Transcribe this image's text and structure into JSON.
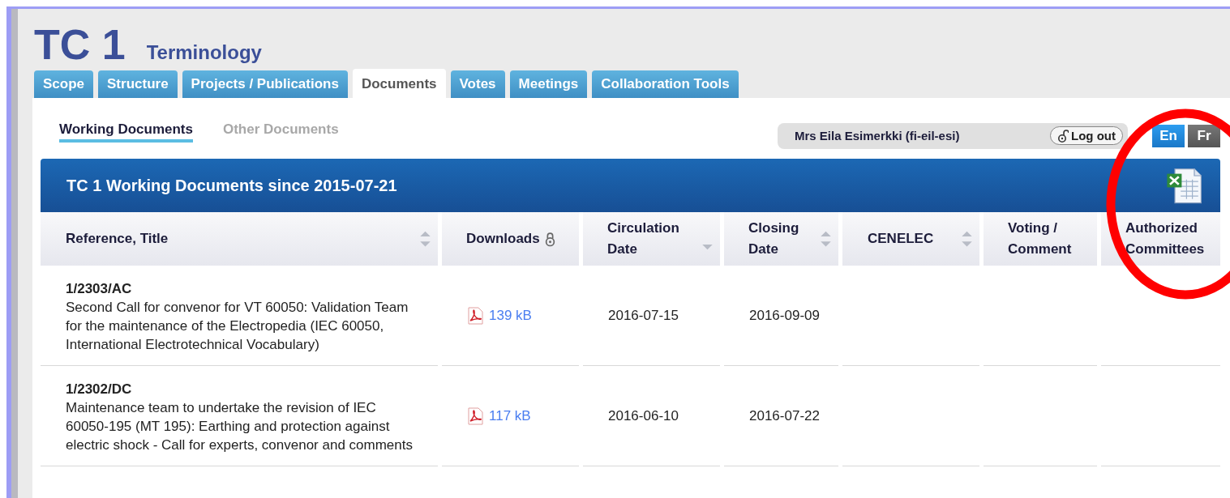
{
  "header": {
    "code": "TC 1",
    "name": "Terminology"
  },
  "tabs": [
    {
      "label": "Scope",
      "selected": false
    },
    {
      "label": "Structure",
      "selected": false
    },
    {
      "label": "Projects / Publications",
      "selected": false
    },
    {
      "label": "Documents",
      "selected": true
    },
    {
      "label": "Votes",
      "selected": false
    },
    {
      "label": "Meetings",
      "selected": false
    },
    {
      "label": "Collaboration Tools",
      "selected": false
    }
  ],
  "subtabs": [
    {
      "label": "Working Documents",
      "selected": true
    },
    {
      "label": "Other Documents",
      "selected": false
    }
  ],
  "user": {
    "name": "Mrs Eila Esimerkki (fi-eil-esi)",
    "logout": "Log out"
  },
  "languages": [
    {
      "label": "En",
      "selected": true
    },
    {
      "label": "Fr",
      "selected": false
    }
  ],
  "table": {
    "title": "TC 1 Working Documents since 2015-07-21",
    "columns": [
      {
        "label": "Reference, Title",
        "sort_up": true,
        "sort_down": true
      },
      {
        "label": "Downloads",
        "sort_up": false,
        "sort_down": false,
        "locked": true
      },
      {
        "label": "Circulation Date",
        "sort_up": false,
        "sort_down": true
      },
      {
        "label": "Closing Date",
        "sort_up": true,
        "sort_down": true
      },
      {
        "label": "CENELEC",
        "sort_up": true,
        "sort_down": true
      },
      {
        "label": "Voting / Comment",
        "sort_up": false,
        "sort_down": false
      },
      {
        "label": "Authorized Committees",
        "sort_up": false,
        "sort_down": false
      }
    ],
    "rows": [
      {
        "reference": "1/2303/AC",
        "title": "Second Call for convenor for VT 60050: Validation Team for the maintenance of the Electropedia (IEC 60050, International Electrotechnical Vocabulary)",
        "download": "139 kB",
        "circulation": "2016-07-15",
        "closing": "2016-09-09"
      },
      {
        "reference": "1/2302/DC",
        "title": "Maintenance team to undertake the revision of IEC 60050-195 (MT 195): Earthing and protection against electric shock - Call for experts, convenor and comments",
        "download": "117 kB",
        "circulation": "2016-06-10",
        "closing": "2016-07-22"
      }
    ]
  },
  "annotation": {
    "kind": "circle"
  }
}
